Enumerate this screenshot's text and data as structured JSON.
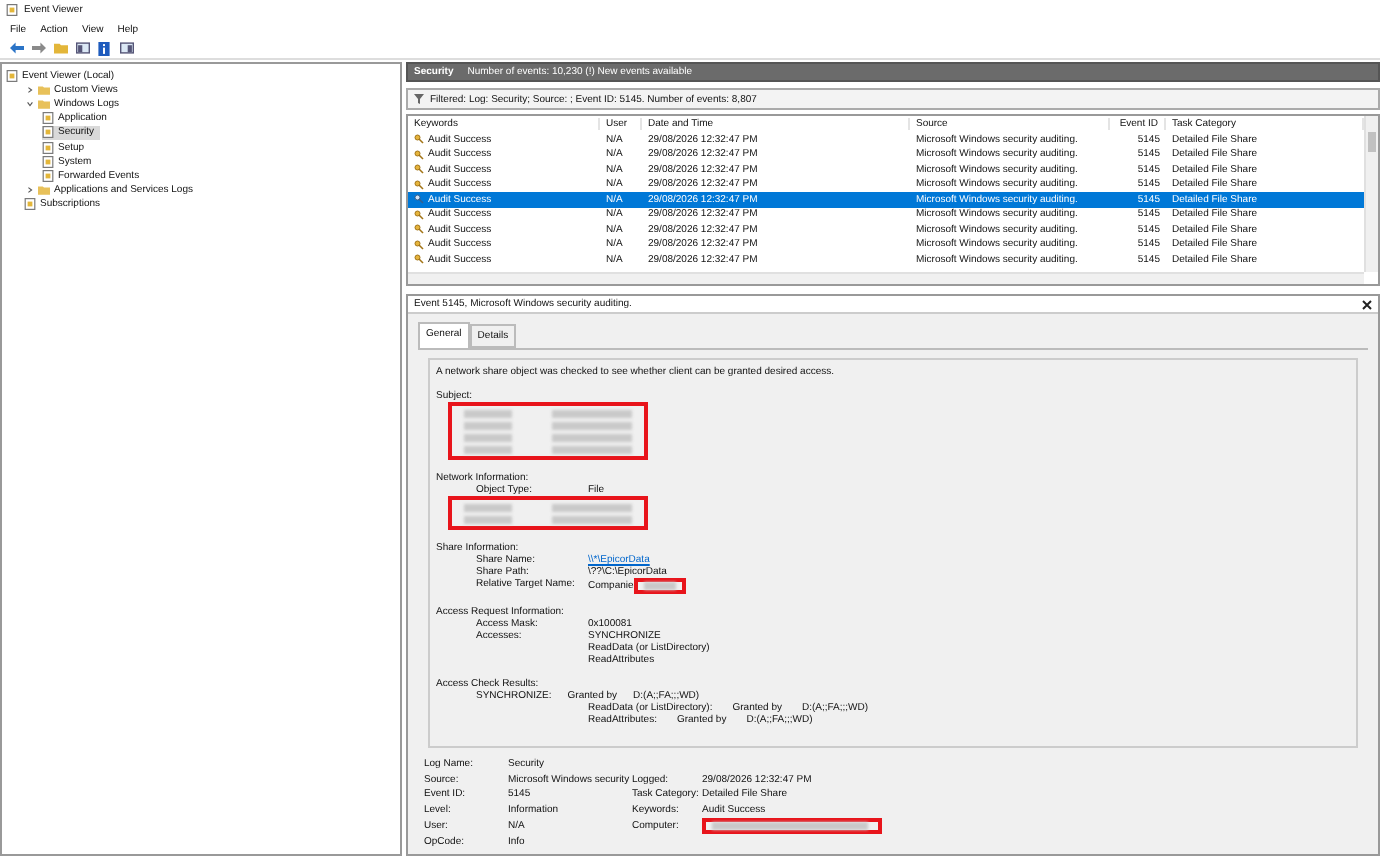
{
  "window": {
    "title": "Event Viewer"
  },
  "menu": [
    {
      "label": "File"
    },
    {
      "label": "Action"
    },
    {
      "label": "View"
    },
    {
      "label": "Help"
    }
  ],
  "tree": [
    {
      "label": "Event Viewer (Local)",
      "selected": false,
      "children": [
        {
          "label": "Custom Views",
          "expanded": false,
          "selected": false
        },
        {
          "label": "Windows Logs",
          "expanded": true,
          "selected": false,
          "children": [
            {
              "label": "Application",
              "selected": false
            },
            {
              "label": "Security",
              "selected": true
            },
            {
              "label": "Setup",
              "selected": false
            },
            {
              "label": "System",
              "selected": false
            },
            {
              "label": "Forwarded Events",
              "selected": false
            }
          ]
        },
        {
          "label": "Applications and Services Logs",
          "expanded": false,
          "selected": false
        },
        {
          "label": "Subscriptions",
          "selected": false
        }
      ]
    }
  ],
  "log_header": {
    "title": "Security",
    "summary": "Number of events: 10,230 (!) New events available"
  },
  "filter": "Filtered: Log: Security; Source: ; Event ID: 5145. Number of events: 8,807",
  "table": {
    "columns": [
      "Keywords",
      "User",
      "Date and Time",
      "Source",
      "Event ID",
      "Task Category"
    ],
    "rows": [
      {
        "keywords": "Audit Success",
        "user": "N/A",
        "date": "29/08/2026 12:32:47 PM",
        "source": "Microsoft Windows security auditing.",
        "event_id": "5145",
        "task_category": "Detailed File Share",
        "selected": false
      },
      {
        "keywords": "Audit Success",
        "user": "N/A",
        "date": "29/08/2026 12:32:47 PM",
        "source": "Microsoft Windows security auditing.",
        "event_id": "5145",
        "task_category": "Detailed File Share",
        "selected": false
      },
      {
        "keywords": "Audit Success",
        "user": "N/A",
        "date": "29/08/2026 12:32:47 PM",
        "source": "Microsoft Windows security auditing.",
        "event_id": "5145",
        "task_category": "Detailed File Share",
        "selected": false
      },
      {
        "keywords": "Audit Success",
        "user": "N/A",
        "date": "29/08/2026 12:32:47 PM",
        "source": "Microsoft Windows security auditing.",
        "event_id": "5145",
        "task_category": "Detailed File Share",
        "selected": false
      },
      {
        "keywords": "Audit Success",
        "user": "N/A",
        "date": "29/08/2026 12:32:47 PM",
        "source": "Microsoft Windows security auditing.",
        "event_id": "5145",
        "task_category": "Detailed File Share",
        "selected": true
      },
      {
        "keywords": "Audit Success",
        "user": "N/A",
        "date": "29/08/2026 12:32:47 PM",
        "source": "Microsoft Windows security auditing.",
        "event_id": "5145",
        "task_category": "Detailed File Share",
        "selected": false
      },
      {
        "keywords": "Audit Success",
        "user": "N/A",
        "date": "29/08/2026 12:32:47 PM",
        "source": "Microsoft Windows security auditing.",
        "event_id": "5145",
        "task_category": "Detailed File Share",
        "selected": false
      },
      {
        "keywords": "Audit Success",
        "user": "N/A",
        "date": "29/08/2026 12:32:47 PM",
        "source": "Microsoft Windows security auditing.",
        "event_id": "5145",
        "task_category": "Detailed File Share",
        "selected": false
      },
      {
        "keywords": "Audit Success",
        "user": "N/A",
        "date": "29/08/2026 12:32:47 PM",
        "source": "Microsoft Windows security auditing.",
        "event_id": "5145",
        "task_category": "Detailed File Share",
        "selected": false
      }
    ]
  },
  "detail": {
    "title": "Event 5145, Microsoft Windows security auditing.",
    "tabs": [
      {
        "label": "General",
        "selected": true
      },
      {
        "label": "Details",
        "selected": false
      }
    ],
    "message": "A network share object was checked to see whether client can be granted desired access.",
    "sections": [
      {
        "heading": "Subject:",
        "rows": [
          {
            "kind": "redacted"
          },
          {
            "kind": "redacted"
          },
          {
            "kind": "redacted"
          },
          {
            "kind": "redacted"
          }
        ]
      },
      {
        "heading": "Network Information:",
        "rows": [
          {
            "kind": "field",
            "label": "Object Type:",
            "values": [
              "File"
            ]
          },
          {
            "kind": "redacted"
          },
          {
            "kind": "redacted"
          }
        ]
      },
      {
        "heading": "Share Information:",
        "rows": [
          {
            "kind": "link",
            "label": "Share Name:",
            "values": [
              "\\\\*\\EpicorData"
            ]
          },
          {
            "kind": "field",
            "label": "Share Path:",
            "values": [
              "\\??\\C:\\EpicorData"
            ]
          },
          {
            "kind": "partial",
            "label": "Relative Target Name:",
            "values": [
              "Companie"
            ]
          }
        ]
      },
      {
        "heading": "Access Request Information:",
        "rows": [
          {
            "kind": "field",
            "label": "Access Mask:",
            "values": [
              "0x100081"
            ]
          },
          {
            "kind": "field",
            "label": "Accesses:",
            "values": [
              "SYNCHRONIZE",
              "ReadData (or ListDirectory)",
              "ReadAttributes"
            ]
          }
        ]
      },
      {
        "heading": "Access Check Results:",
        "rows": [
          {
            "kind": "check",
            "parts": [
              "SYNCHRONIZE:",
              "Granted by",
              "D:(A;;FA;;;WD)"
            ]
          },
          {
            "kind": "check_more",
            "parts": [
              "ReadData (or ListDirectory):",
              "Granted by",
              "D:(A;;FA;;;WD)"
            ]
          },
          {
            "kind": "check_more",
            "parts": [
              "ReadAttributes:",
              "Granted by",
              "D:(A;;FA;;;WD)"
            ]
          }
        ]
      }
    ],
    "summary": [
      {
        "left": {
          "label": "Log Name:",
          "value": "Security"
        }
      },
      {
        "left": {
          "label": "Source:",
          "value": "Microsoft Windows security"
        },
        "right": {
          "label": "Logged:",
          "value": "29/08/2026 12:32:47 PM"
        }
      },
      {
        "left": {
          "label": "Event ID:",
          "value": "5145"
        },
        "right": {
          "label": "Task Category:",
          "value": "Detailed File Share"
        }
      },
      {
        "left": {
          "label": "Level:",
          "value": "Information"
        },
        "right": {
          "label": "Keywords:",
          "value": "Audit Success"
        }
      },
      {
        "left": {
          "label": "User:",
          "value": "N/A"
        },
        "right": {
          "label": "Computer:",
          "redacted": true
        }
      },
      {
        "left": {
          "label": "OpCode:",
          "value": "Info"
        }
      }
    ]
  }
}
